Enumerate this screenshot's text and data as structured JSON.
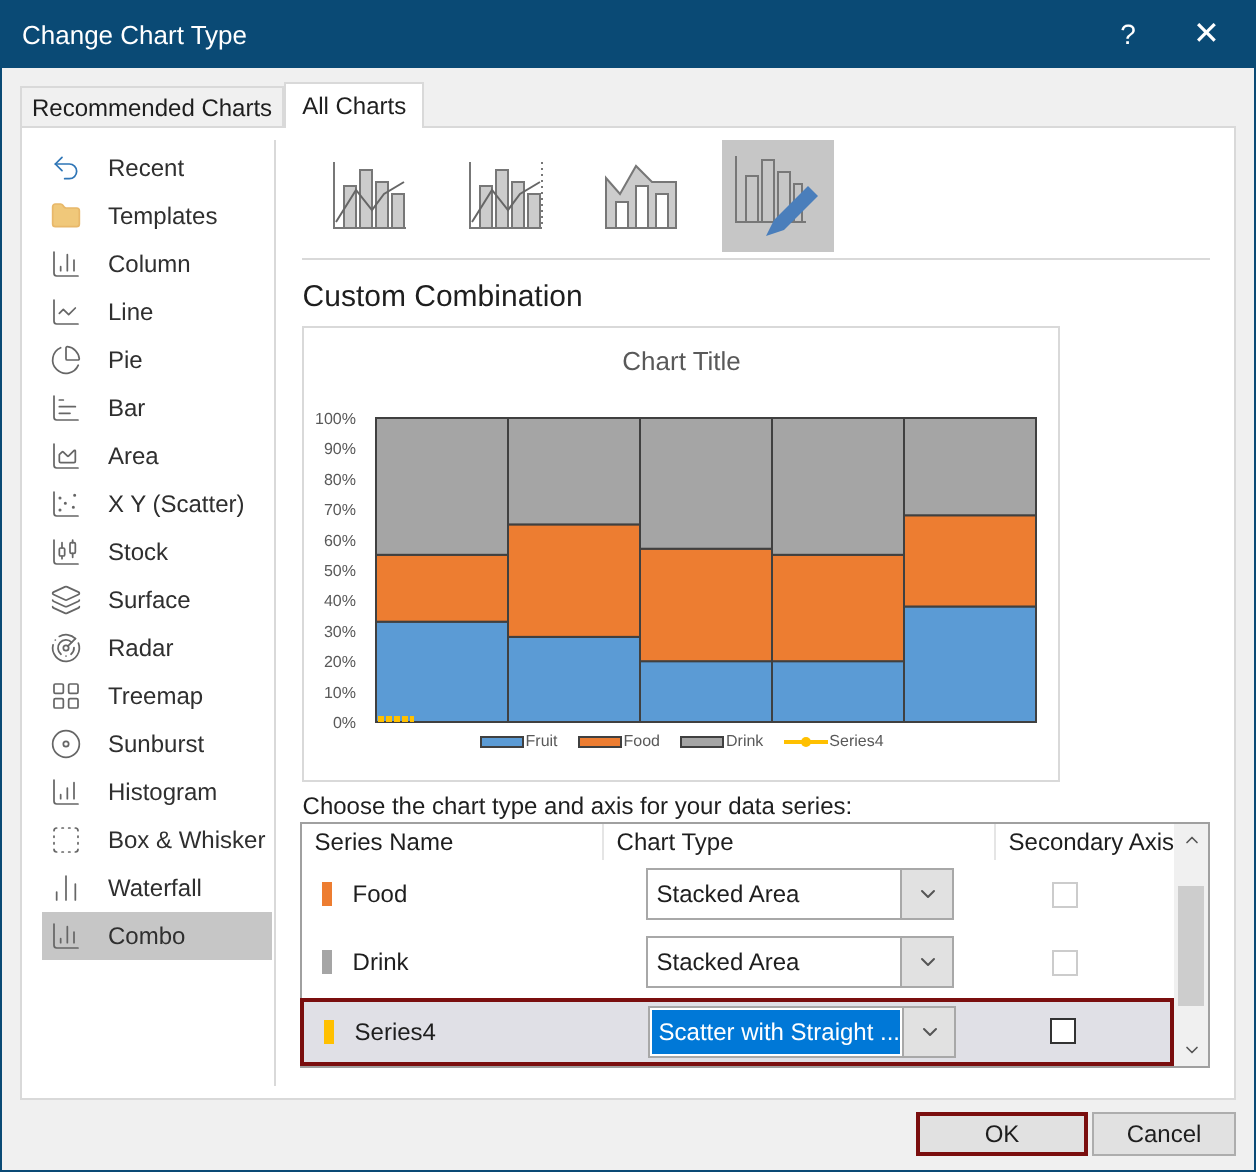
{
  "window": {
    "title": "Change Chart Type",
    "help": "?",
    "close": "✕"
  },
  "tabs": [
    {
      "label": "Recommended Charts",
      "selected": false
    },
    {
      "label": "All Charts",
      "selected": true
    }
  ],
  "sidebar": {
    "items": [
      {
        "label": "Recent",
        "kind": "recent",
        "selected": false
      },
      {
        "label": "Templates",
        "kind": "templates",
        "selected": false
      },
      {
        "label": "Column",
        "kind": "column",
        "selected": false
      },
      {
        "label": "Line",
        "kind": "line",
        "selected": false
      },
      {
        "label": "Pie",
        "kind": "pie",
        "selected": false
      },
      {
        "label": "Bar",
        "kind": "bar",
        "selected": false
      },
      {
        "label": "Area",
        "kind": "area",
        "selected": false
      },
      {
        "label": "X Y (Scatter)",
        "kind": "scatter",
        "selected": false
      },
      {
        "label": "Stock",
        "kind": "stock",
        "selected": false
      },
      {
        "label": "Surface",
        "kind": "surface",
        "selected": false
      },
      {
        "label": "Radar",
        "kind": "radar",
        "selected": false
      },
      {
        "label": "Treemap",
        "kind": "treemap",
        "selected": false
      },
      {
        "label": "Sunburst",
        "kind": "sunburst",
        "selected": false
      },
      {
        "label": "Histogram",
        "kind": "histogram",
        "selected": false
      },
      {
        "label": "Box & Whisker",
        "kind": "box",
        "selected": false
      },
      {
        "label": "Waterfall",
        "kind": "waterfall",
        "selected": false
      },
      {
        "label": "Combo",
        "kind": "combo",
        "selected": true
      }
    ]
  },
  "subtypes": [
    {
      "kind": "column-line",
      "selected": false
    },
    {
      "kind": "column-line-secondary",
      "selected": false
    },
    {
      "kind": "area-column",
      "selected": false
    },
    {
      "kind": "custom",
      "selected": true
    }
  ],
  "section_title": "Custom Combination",
  "chart": {
    "chart_data": {
      "type": "bar",
      "stacked": true,
      "title": "Chart Title",
      "yticks": [
        {
          "value": 0,
          "label": "0%"
        },
        {
          "value": 10,
          "label": "10%"
        },
        {
          "value": 20,
          "label": "20%"
        },
        {
          "value": 30,
          "label": "30%"
        },
        {
          "value": 40,
          "label": "40%"
        },
        {
          "value": 50,
          "label": "50%"
        },
        {
          "value": 60,
          "label": "60%"
        },
        {
          "value": 70,
          "label": "70%"
        },
        {
          "value": 80,
          "label": "80%"
        },
        {
          "value": 90,
          "label": "90%"
        },
        {
          "value": 100,
          "label": "100%"
        }
      ],
      "ylim": [
        0,
        100
      ],
      "legend": "bottom",
      "categories": [
        null,
        null,
        null,
        null,
        null
      ],
      "series": [
        {
          "name": "Fruit",
          "color": "#5b9bd5",
          "values": [
            33,
            28,
            20,
            20,
            38
          ]
        },
        {
          "name": "Food",
          "color": "#ed7d31",
          "values": [
            22,
            37,
            37,
            35,
            30
          ]
        },
        {
          "name": "Drink",
          "color": "#a5a5a5",
          "values": [
            45,
            35,
            43,
            45,
            32
          ]
        }
      ]
    },
    "scatter_series": {
      "name": "Series4",
      "color": "#ffc000"
    }
  },
  "series_table": {
    "prompt": "Choose the chart type and axis for your data series:",
    "columns": [
      "Series Name",
      "Chart Type",
      "Secondary Axis"
    ],
    "rows": [
      {
        "name": "Food",
        "color": "#ed7d31",
        "chart_type": "Stacked Area",
        "secondary_axis": false,
        "disabled": true,
        "selected": false
      },
      {
        "name": "Drink",
        "color": "#a5a5a5",
        "chart_type": "Stacked Area",
        "secondary_axis": false,
        "disabled": true,
        "selected": false
      },
      {
        "name": "Series4",
        "color": "#ffc000",
        "chart_type": "Scatter with Straight ...",
        "secondary_axis": false,
        "disabled": false,
        "selected": true
      }
    ]
  },
  "buttons": [
    {
      "label": "OK",
      "default": true
    },
    {
      "label": "Cancel",
      "default": false
    }
  ]
}
